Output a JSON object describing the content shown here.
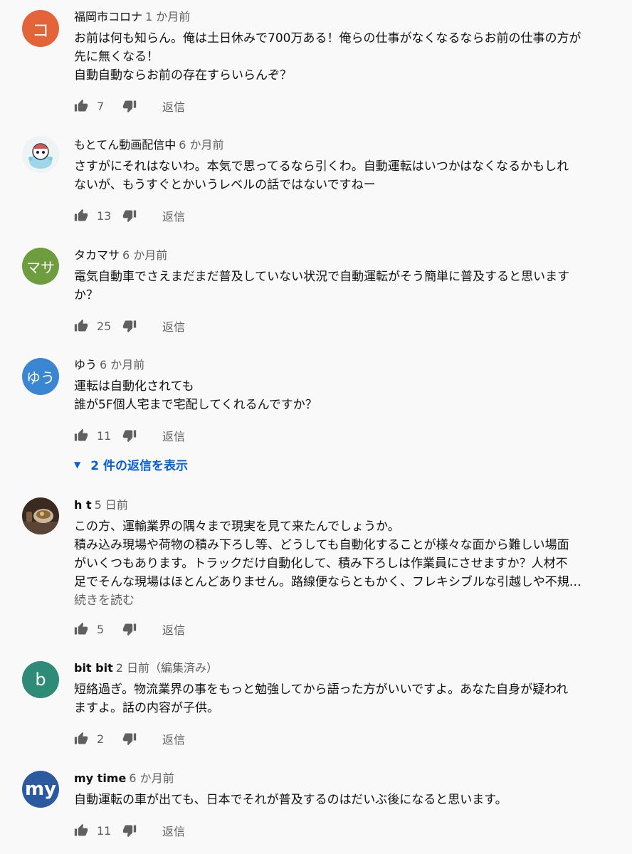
{
  "comments": [
    {
      "author": "福岡市コロナ",
      "time": "1 か月前",
      "avatar_text": "コ",
      "avatar_color": "#e4643a",
      "lines": [
        "お前は何も知らん。俺は土日休みで700万ある！俺らの仕事がなくなるならお前の仕事の方が",
        "先に無くなる！",
        "自動自動ならお前の存在すらいらんぞ？"
      ],
      "likes": "7",
      "reply": "返信"
    },
    {
      "author": "もとてん動画配信中",
      "time": "6 か月前",
      "avatar_text": "",
      "avatar_color": "#e8eef0",
      "lines": [
        "さすがにそれはないわ。本気で思ってるなら引くわ。自動運転はいつかはなくなるかもしれ",
        "ないが、もうすぐとかいうレベルの話ではないですねー"
      ],
      "likes": "13",
      "reply": "返信"
    },
    {
      "author": "タカマサ",
      "time": "6 か月前",
      "avatar_text": "マサ",
      "avatar_color": "#6e9d3e",
      "lines": [
        "電気自動車でさえまだまだ普及していない状況で自動運転がそう簡単に普及すると思います",
        "か？"
      ],
      "likes": "25",
      "reply": "返信"
    },
    {
      "author": "ゆう",
      "time": "6 か月前",
      "avatar_text": "ゆう",
      "avatar_color": "#3a86d3",
      "lines": [
        "運転は自動化されても",
        "誰が5F個人宅まで宅配してくれるんですか？"
      ],
      "likes": "11",
      "reply": "返信",
      "replies_label": "2 件の返信を表示"
    },
    {
      "author": "h t",
      "time": "5 日前",
      "avatar_text": "",
      "avatar_color": "#4a3b30",
      "lines": [
        "この方、運輸業界の隅々まで現実を見て来たんでしょうか。",
        "積み込み現場や荷物の積み下ろし等、どうしても自動化することが様々な面から難しい場面",
        "がいくつもあります。トラックだけ自動化して、積み下ろしは作業員にさせますか？人材不",
        "足でそんな現場はほとんどありません。路線便ならともかく、フレキシブルな引越しや不規…"
      ],
      "read_more": "続きを読む",
      "likes": "5",
      "reply": "返信"
    },
    {
      "author": "bit bit",
      "time": "2 日前（編集済み）",
      "avatar_text": "b",
      "avatar_color": "#2e8b77",
      "lines": [
        "短絡過ぎ。物流業界の事をもっと勉強してから語った方がいいですよ。あなた自身が疑われ",
        "ますよ。話の内容が子供。"
      ],
      "likes": "2",
      "reply": "返信"
    },
    {
      "author": "my time",
      "time": "6 か月前",
      "avatar_text": "my",
      "avatar_color": "#2c5aa0",
      "lines": [
        "自動運転の車が出ても、日本でそれが普及するのはだいぶ後になると思います。"
      ],
      "likes": "11",
      "reply": "返信"
    }
  ]
}
